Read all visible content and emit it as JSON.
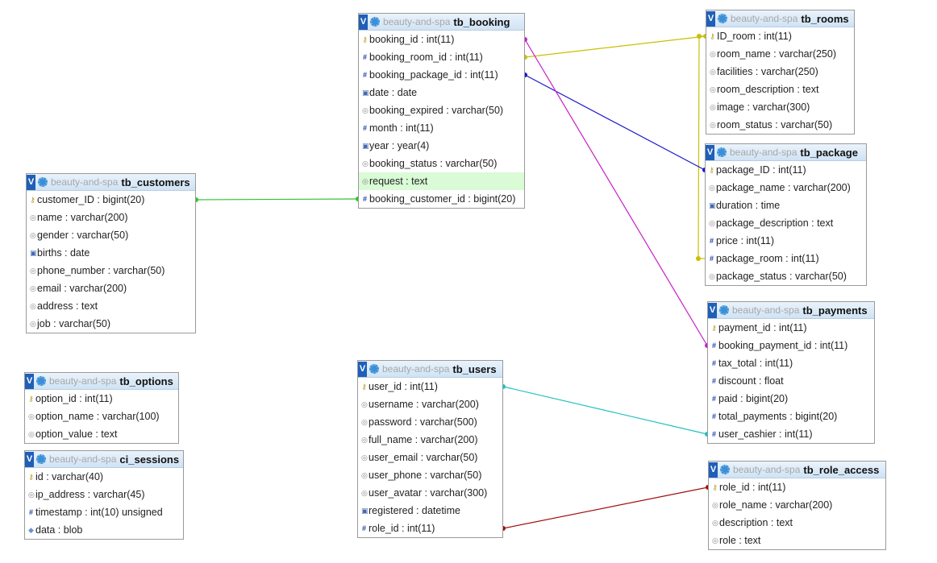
{
  "db": "beauty-and-spa",
  "view_button": "V",
  "tables": {
    "tb_booking": {
      "name": "tb_booking",
      "fields": [
        {
          "label": "booking_id : int(11)",
          "icon": "key-icon"
        },
        {
          "label": "booking_room_id : int(11)",
          "icon": "hash-icon"
        },
        {
          "label": "booking_package_id : int(11)",
          "icon": "hash-icon"
        },
        {
          "label": "date : date",
          "icon": "date-icon"
        },
        {
          "label": "booking_expired : varchar(50)",
          "icon": "text-icon"
        },
        {
          "label": "month : int(11)",
          "icon": "hash-icon"
        },
        {
          "label": "year : year(4)",
          "icon": "date-icon"
        },
        {
          "label": "booking_status : varchar(50)",
          "icon": "text-icon"
        },
        {
          "label": "request : text",
          "icon": "text-icon",
          "highlight": true
        },
        {
          "label": "booking_customer_id : bigint(20)",
          "icon": "hash-icon"
        }
      ]
    },
    "tb_rooms": {
      "name": "tb_rooms",
      "fields": [
        {
          "label": "ID_room : int(11)",
          "icon": "key-icon"
        },
        {
          "label": "room_name : varchar(250)",
          "icon": "text-icon"
        },
        {
          "label": "facilities : varchar(250)",
          "icon": "text-icon"
        },
        {
          "label": "room_description : text",
          "icon": "text-icon"
        },
        {
          "label": "image : varchar(300)",
          "icon": "text-icon"
        },
        {
          "label": "room_status : varchar(50)",
          "icon": "text-icon"
        }
      ]
    },
    "tb_package": {
      "name": "tb_package",
      "fields": [
        {
          "label": "package_ID : int(11)",
          "icon": "key-icon"
        },
        {
          "label": "package_name : varchar(200)",
          "icon": "text-icon"
        },
        {
          "label": "duration : time",
          "icon": "date-icon"
        },
        {
          "label": "package_description : text",
          "icon": "text-icon"
        },
        {
          "label": "price : int(11)",
          "icon": "hash-icon"
        },
        {
          "label": "package_room : int(11)",
          "icon": "hash-icon"
        },
        {
          "label": "package_status : varchar(50)",
          "icon": "text-icon"
        }
      ]
    },
    "tb_customers": {
      "name": "tb_customers",
      "fields": [
        {
          "label": "customer_ID : bigint(20)",
          "icon": "key-icon"
        },
        {
          "label": "name : varchar(200)",
          "icon": "text-icon"
        },
        {
          "label": "gender : varchar(50)",
          "icon": "text-icon"
        },
        {
          "label": "births : date",
          "icon": "date-icon"
        },
        {
          "label": "phone_number : varchar(50)",
          "icon": "text-icon"
        },
        {
          "label": "email : varchar(200)",
          "icon": "text-icon"
        },
        {
          "label": "address : text",
          "icon": "text-icon"
        },
        {
          "label": "job : varchar(50)",
          "icon": "text-icon"
        }
      ]
    },
    "tb_payments": {
      "name": "tb_payments",
      "fields": [
        {
          "label": "payment_id : int(11)",
          "icon": "key-icon"
        },
        {
          "label": "booking_payment_id : int(11)",
          "icon": "hash-icon"
        },
        {
          "label": "tax_total : int(11)",
          "icon": "hash-icon"
        },
        {
          "label": "discount : float",
          "icon": "hash-icon"
        },
        {
          "label": "paid : bigint(20)",
          "icon": "hash-icon"
        },
        {
          "label": "total_payments : bigint(20)",
          "icon": "hash-icon"
        },
        {
          "label": "user_cashier : int(11)",
          "icon": "hash-icon"
        }
      ]
    },
    "tb_options": {
      "name": "tb_options",
      "fields": [
        {
          "label": "option_id : int(11)",
          "icon": "key-icon"
        },
        {
          "label": "option_name : varchar(100)",
          "icon": "text-icon"
        },
        {
          "label": "option_value : text",
          "icon": "text-icon"
        }
      ]
    },
    "ci_sessions": {
      "name": "ci_sessions",
      "fields": [
        {
          "label": "id : varchar(40)",
          "icon": "key-icon"
        },
        {
          "label": "ip_address : varchar(45)",
          "icon": "text-icon"
        },
        {
          "label": "timestamp : int(10) unsigned",
          "icon": "hash-icon"
        },
        {
          "label": "data : blob",
          "icon": "blob-icon"
        }
      ]
    },
    "tb_users": {
      "name": "tb_users",
      "fields": [
        {
          "label": "user_id : int(11)",
          "icon": "key-icon"
        },
        {
          "label": "username : varchar(200)",
          "icon": "text-icon"
        },
        {
          "label": "password : varchar(500)",
          "icon": "text-icon"
        },
        {
          "label": "full_name : varchar(200)",
          "icon": "text-icon"
        },
        {
          "label": "user_email : varchar(50)",
          "icon": "text-icon"
        },
        {
          "label": "user_phone : varchar(50)",
          "icon": "text-icon"
        },
        {
          "label": "user_avatar : varchar(300)",
          "icon": "text-icon"
        },
        {
          "label": "registered : datetime",
          "icon": "date-icon"
        },
        {
          "label": "role_id : int(11)",
          "icon": "hash-icon"
        }
      ]
    },
    "tb_role_access": {
      "name": "tb_role_access",
      "fields": [
        {
          "label": "role_id : int(11)",
          "icon": "key-icon"
        },
        {
          "label": "role_name : varchar(200)",
          "icon": "text-icon"
        },
        {
          "label": "description : text",
          "icon": "text-icon"
        },
        {
          "label": "role : text",
          "icon": "text-icon"
        }
      ]
    }
  },
  "relations": [
    {
      "from": "tb_booking.booking_room_id",
      "to": "tb_rooms.ID_room",
      "color": "#c9c000"
    },
    {
      "from": "tb_package.package_room",
      "to": "tb_rooms.ID_room",
      "color": "#c9c000"
    },
    {
      "from": "tb_booking.booking_package_id",
      "to": "tb_package.package_ID",
      "color": "#1a1ac8"
    },
    {
      "from": "tb_booking.booking_customer_id",
      "to": "tb_customers.customer_ID",
      "color": "#2ec22e"
    },
    {
      "from": "tb_payments.booking_payment_id",
      "to": "tb_booking.booking_id",
      "color": "#c81ec8"
    },
    {
      "from": "tb_payments.user_cashier",
      "to": "tb_users.user_id",
      "color": "#20c0c0"
    },
    {
      "from": "tb_users.role_id",
      "to": "tb_role_access.role_id",
      "color": "#a01010"
    }
  ]
}
